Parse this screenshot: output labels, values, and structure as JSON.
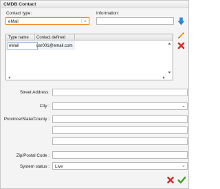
{
  "window": {
    "title": "CMDB Contact"
  },
  "form": {
    "contact_type_label": "Contact type:",
    "contact_type_value": "eMail",
    "information_label": "Information:",
    "information_value": "",
    "street_label": "Street Address:",
    "city_label": "City :",
    "province_label": "Province/State/County :",
    "zip_label": "Zip/Postal Code :",
    "system_status_label": "System status :",
    "system_status_value": "Live"
  },
  "grid": {
    "headers": [
      "Type name",
      "Contact defined"
    ],
    "rows": [
      {
        "type": "eMail",
        "contact": "usr001@email.com"
      }
    ]
  },
  "icons": {
    "add": "download-arrow-icon",
    "edit": "pencil-icon",
    "delete": "red-x-icon",
    "cancel": "red-x-icon",
    "save": "green-check-icon"
  },
  "colors": {
    "focus_border": "#f08a24",
    "arrow_blue": "#2b86d6",
    "delete_red": "#d42b2b",
    "check_green": "#4aa12a"
  }
}
